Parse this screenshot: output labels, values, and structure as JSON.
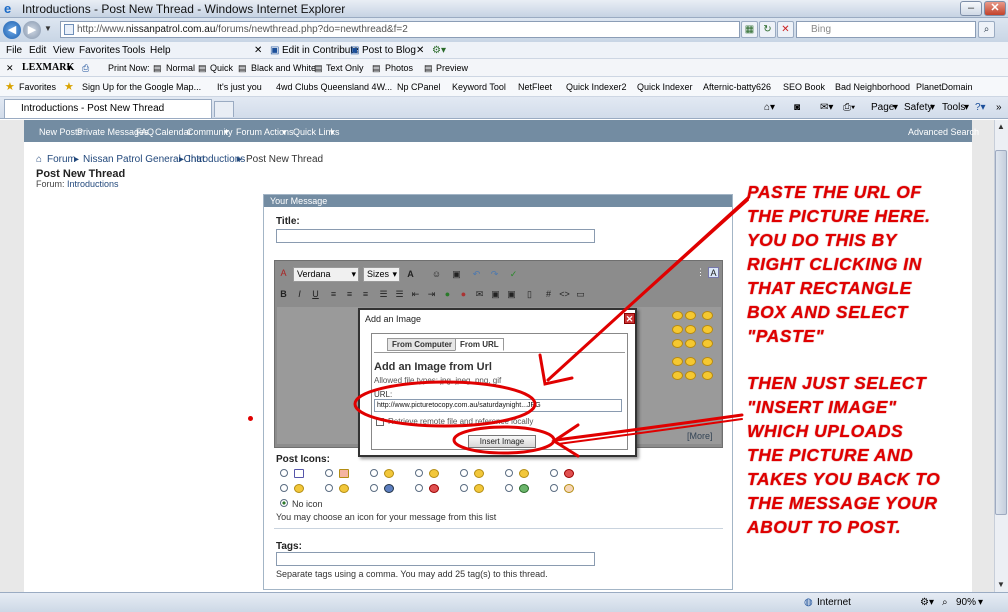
{
  "window": {
    "title": "Introductions - Post New Thread - Windows Internet Explorer"
  },
  "address_bar": {
    "url_prefix": "http://www.",
    "url_host": "nissanpatrol.com.au",
    "url_path": "/forums/newthread.php?do=newthread&f=2",
    "search_placeholder": "Bing"
  },
  "menu_bar": {
    "items": [
      "File",
      "Edit",
      "View",
      "Favorites",
      "Tools",
      "Help"
    ],
    "contribute": "Edit in Contribute",
    "post_to_blog": "Post to Blog"
  },
  "lexmark_bar": {
    "brand": "LEXMARK",
    "print_now": "Print Now:",
    "normal": "Normal",
    "quick": "Quick",
    "black_white": "Black and White",
    "text_only": "Text Only",
    "photos": "Photos",
    "preview": "Preview"
  },
  "favorites_bar": {
    "favorites": "Favorites",
    "links": [
      "Sign Up for the Google Map...",
      "It's just you",
      "4wd Clubs  Queensland  4W...",
      "Np CPanel",
      "Keyword Tool",
      "NetFleet",
      "Quick Indexer2",
      "Quick Indexer",
      "Afternic-batty626",
      "SEO Book",
      "Bad Neighborhood",
      "PlanetDomain"
    ]
  },
  "tab_bar": {
    "active_tab": "Introductions - Post New Thread",
    "page_menu": "Page",
    "safety_menu": "Safety",
    "tools_menu": "Tools"
  },
  "forum_nav": {
    "items": [
      "New Posts",
      "Private Messages",
      "FAQ",
      "Calendar",
      "Community",
      "Forum Actions",
      "Quick Links"
    ],
    "advanced_search": "Advanced Search"
  },
  "breadcrumb": [
    "Forum",
    "Nissan Patrol General Chat",
    "Introductions",
    "Post New Thread"
  ],
  "page": {
    "title": "Post New Thread",
    "forum_label": "Forum:",
    "forum_name": "Introductions"
  },
  "message_panel": {
    "header": "Your Message",
    "title_label": "Title:",
    "font_value": "Verdana",
    "size_value": "Sizes",
    "more_link": "[More]"
  },
  "dialog": {
    "title": "Add an Image",
    "tab_computer": "From Computer",
    "tab_url": "From URL",
    "heading": "Add an Image from Url",
    "allowed": "Allowed file types: jpg, jpeg, png, gif",
    "url_label": "URL:",
    "url_value": "http://www.picturetocopy.com.au/saturdaynight...JPG",
    "checkbox_label": "Retrieve remote file and reference locally",
    "insert_button": "Insert Image"
  },
  "post_icons": {
    "label": "Post Icons:",
    "no_icon": "No icon",
    "hint": "You may choose an icon for your message from this list"
  },
  "tags": {
    "label": "Tags:",
    "hint": "Separate tags using a comma. You may add 25 tag(s) to this thread."
  },
  "annotations": {
    "top": "PASTE THE URL OF\nTHE PICTURE HERE.\nYOU DO THIS BY\nRIGHT CLICKING IN\nTHAT RECTANGLE\nBOX AND SELECT\n\"PASTE\"",
    "bottom": "THEN JUST SELECT\n\"INSERT IMAGE\"\nWHICH UPLOADS\nTHE PICTURE AND\nTAKES YOU BACK TO\nTHE MESSAGE YOUR\nABOUT TO POST.",
    "color": "#e00000"
  },
  "status_bar": {
    "zone": "Internet",
    "zoom": "90%"
  }
}
